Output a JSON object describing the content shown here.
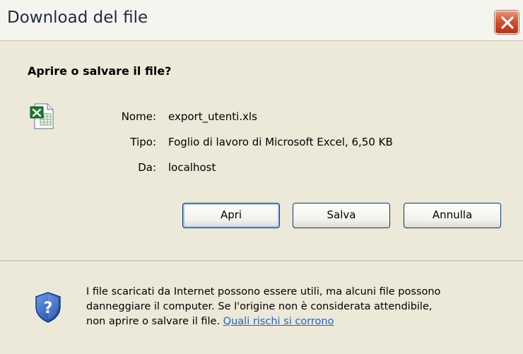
{
  "window": {
    "title": "Download del file"
  },
  "dialog": {
    "question": "Aprire o salvare il file?",
    "file": {
      "icon": "excel-file-icon",
      "name_label": "Nome:",
      "name_value": "export_utenti.xls",
      "type_label": "Tipo:",
      "type_value": "Foglio di lavoro di Microsoft Excel, 6,50 KB",
      "from_label": "Da:",
      "from_value": "localhost"
    },
    "buttons": {
      "open": "Apri",
      "save": "Salva",
      "cancel": "Annulla"
    },
    "warning": {
      "icon": "shield-question-icon",
      "line1": "I file scaricati da Internet possono essere utili, ma alcuni file possono",
      "line2": "danneggiare il computer. Se l'origine non è considerata attendibile,",
      "line3": "non aprire o salvare il file.",
      "link": "Quali rischi si corrono"
    }
  },
  "colors": {
    "dialog_bg": "#ece9d8",
    "close_button": "#d4512a",
    "link": "#1f5fd8"
  }
}
